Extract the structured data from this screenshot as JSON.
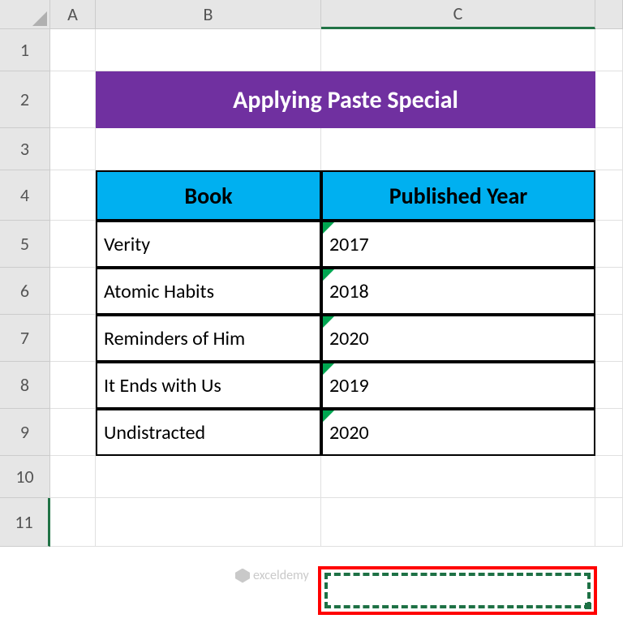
{
  "columns": {
    "a": "A",
    "b": "B",
    "c": "C"
  },
  "rows": {
    "r1": "1",
    "r2": "2",
    "r3": "3",
    "r4": "4",
    "r5": "5",
    "r6": "6",
    "r7": "7",
    "r8": "8",
    "r9": "9",
    "r10": "10",
    "r11": "11"
  },
  "title": "Applying Paste Special",
  "headers": {
    "book": "Book",
    "year": "Published Year"
  },
  "data": [
    {
      "book": "Verity",
      "year": "2017"
    },
    {
      "book": "Atomic Habits",
      "year": "2018"
    },
    {
      "book": "Reminders of Him",
      "year": "2020"
    },
    {
      "book": "It Ends with Us",
      "year": "2019"
    },
    {
      "book": "Undistracted",
      "year": "2020"
    }
  ],
  "watermark": "exceldemy",
  "colors": {
    "title_bg": "#7030a0",
    "header_bg": "#00b0f0",
    "selection": "#217346",
    "highlight": "#ff0000"
  },
  "chart_data": {
    "type": "table",
    "title": "Applying Paste Special",
    "columns": [
      "Book",
      "Published Year"
    ],
    "rows": [
      [
        "Verity",
        2017
      ],
      [
        "Atomic Habits",
        2018
      ],
      [
        "Reminders of Him",
        2020
      ],
      [
        "It Ends with Us",
        2019
      ],
      [
        "Undistracted",
        2020
      ]
    ]
  }
}
